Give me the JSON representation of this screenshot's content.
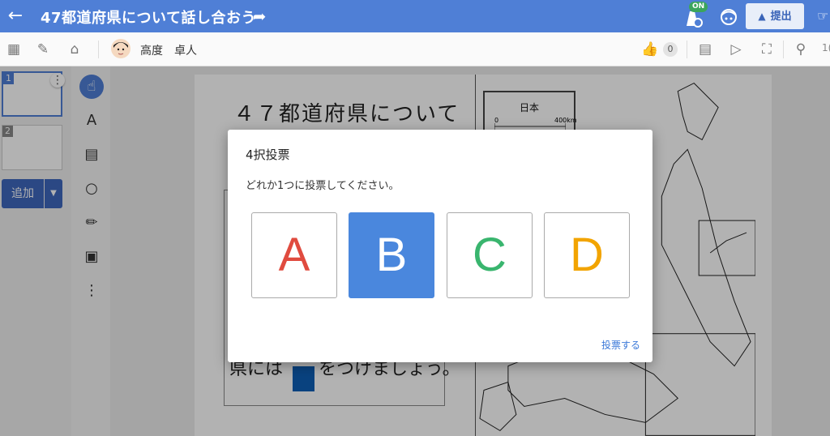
{
  "header": {
    "title": "47都道府県について話し合おう",
    "on_badge": "ON",
    "submit_label": "提出"
  },
  "toolbar": {
    "user_name": "高度　卓人",
    "like_count": "0",
    "zoom_text": "1("
  },
  "sidebar": {
    "slides": [
      {
        "number": "1"
      },
      {
        "number": "2"
      }
    ],
    "add_label": "追加"
  },
  "tools": {
    "text_tool": "A"
  },
  "canvas": {
    "title": "４７都道府県について",
    "body_text": "県には　　をつけましょう。",
    "map_title": "日本",
    "map_scale_min": "0",
    "map_scale_max": "400km"
  },
  "dialog": {
    "title": "4択投票",
    "message": "どれか1つに投票してください。",
    "choices": [
      {
        "label": "A",
        "color": "#e04b3f",
        "selected": false
      },
      {
        "label": "B",
        "color": "#ffffff",
        "background": "#4a87dd",
        "selected": true
      },
      {
        "label": "C",
        "color": "#39b56e",
        "selected": false
      },
      {
        "label": "D",
        "color": "#f2a400",
        "selected": false
      }
    ],
    "vote_button": "投票する"
  },
  "colors": {
    "header": "#4f7fd6",
    "accent": "#4a87dd"
  }
}
